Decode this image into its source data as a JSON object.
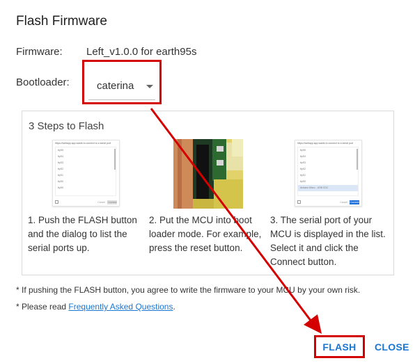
{
  "dialog": {
    "title": "Flash Firmware",
    "firmware_label": "Firmware:",
    "firmware_value": "Left_v1.0.0 for earth95s",
    "bootloader_label": "Bootloader:",
    "bootloader_value": "caterina"
  },
  "steps": {
    "heading": "3 Steps to Flash",
    "step1": {
      "caption": "1. Push the FLASH button and the dialog to list the serial ports up.",
      "mock": {
        "header": "https://webapp.app wants to connect to a serial port",
        "items": [
          "ttyS5",
          "ttyS4",
          "ttyS3",
          "ttyS2",
          "ttyS1",
          "ttyS0",
          "ttyS9"
        ],
        "cancel": "Cancel",
        "connect": "Connect"
      }
    },
    "step2": {
      "caption": "2. Put the MCU into boot loader mode. For example, press the reset button."
    },
    "step3": {
      "caption": "3. The serial port of your MCU is displayed in the list. Select it and click the Connect button.",
      "mock": {
        "header": "https://webapp.app wants to connect to a serial port",
        "items": [
          "ttyS5",
          "ttyS4",
          "ttyS3",
          "ttyS2",
          "ttyS1",
          "ttyS0",
          "ttyS9"
        ],
        "selected_item": "Arduino Micro - USB CDC",
        "cancel": "Cancel",
        "connect": "Connect"
      }
    }
  },
  "notes": {
    "risk": "* If pushing the FLASH button, you agree to write the firmware to your MCU by your own risk.",
    "faq_prefix": "* Please read ",
    "faq_link": "Frequently Asked Questions",
    "faq_suffix": "."
  },
  "actions": {
    "flash": "FLASH",
    "close": "CLOSE"
  },
  "colors": {
    "accent": "#1976d2",
    "annotation": "#d40000"
  }
}
